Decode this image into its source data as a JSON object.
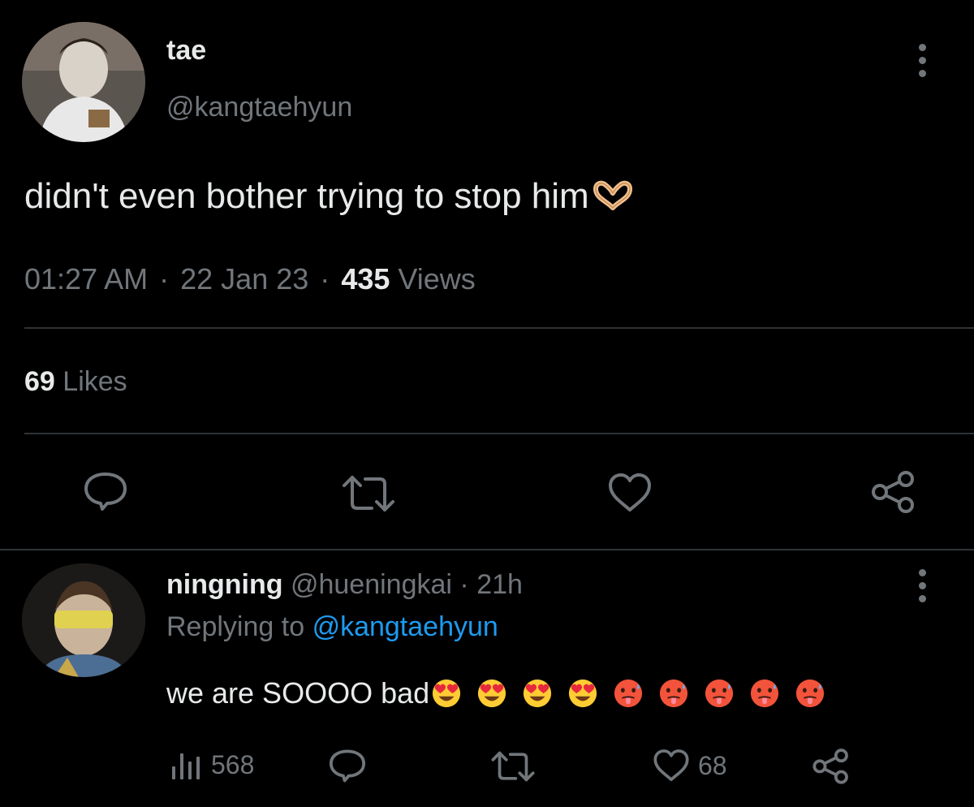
{
  "tweet": {
    "display_name": "tae",
    "handle": "@kangtaehyun",
    "text": "didn't even bother trying to stop him",
    "emoji": "heart-hands",
    "time": "01:27 AM",
    "date": "22 Jan 23",
    "sep": "·",
    "views_count": "435",
    "views_label": "Views",
    "likes_count": "69",
    "likes_label": "Likes"
  },
  "reply": {
    "display_name": "ningning",
    "handle": "@hueningkai",
    "sep": "·",
    "time": "21h",
    "replying_prefix": "Replying to",
    "replying_handle": "@kangtaehyun",
    "text": "we are SOOOO bad",
    "emojis": [
      "heart-eyes",
      "heart-eyes",
      "heart-eyes",
      "heart-eyes",
      "hot-face",
      "hot-face",
      "hot-face",
      "hot-face",
      "hot-face"
    ],
    "views": "568",
    "likes": "68"
  },
  "colors": {
    "background": "#000000",
    "text": "#e7e9ea",
    "muted": "#71767b",
    "accent": "#1d9bf0",
    "divider": "#2f3336"
  },
  "icons": [
    "reply-icon",
    "retweet-icon",
    "like-icon",
    "share-icon",
    "views-icon",
    "more-icon"
  ]
}
